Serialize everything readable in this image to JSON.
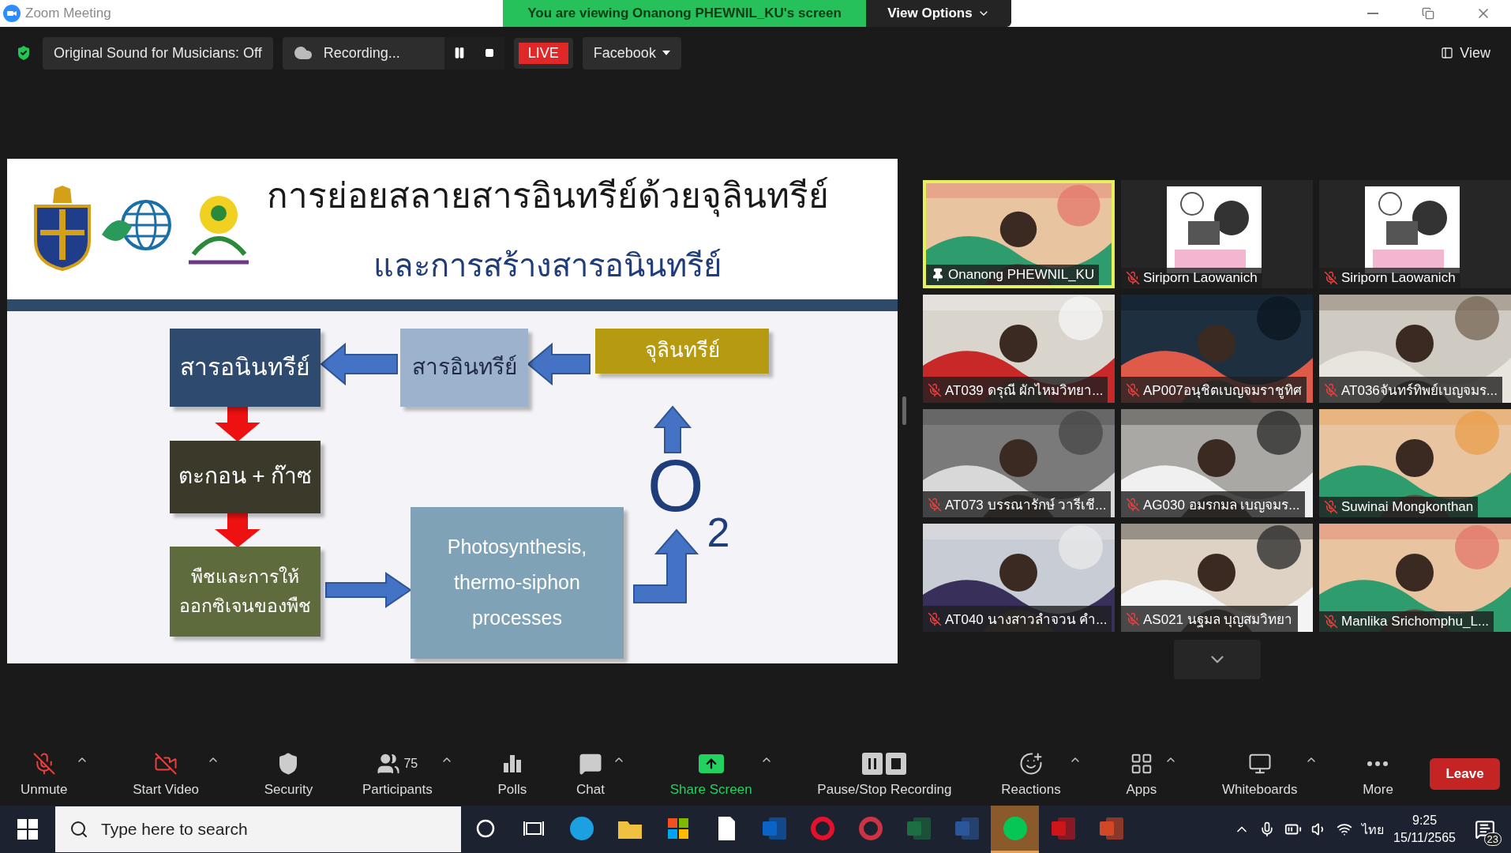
{
  "window": {
    "title": "Zoom Meeting",
    "banner": "You are viewing Onanong PHEWNIL_KU's screen",
    "view_options": "View Options"
  },
  "meeting_bar": {
    "sound_button": "Original Sound for Musicians: Off",
    "recording": "Recording...",
    "live": "LIVE",
    "stream_target": "Facebook",
    "view": "View"
  },
  "slide": {
    "title": "การย่อยสลายสารอินทรีย์ด้วยจุลินทรีย์",
    "subtitle": "และการสร้างสารอนินทรีย์",
    "nodes": [
      {
        "text": "สารอนินทรีย์",
        "color": "#2e4a6e"
      },
      {
        "text": "สารอินทรีย์",
        "color": "#9db2cc"
      },
      {
        "text": "จุลินทรีย์",
        "color": "#b59a12"
      },
      {
        "text": "ตะกอน + ก๊าซ",
        "color": "#3b3a2a"
      },
      {
        "text": "พืชและการให้ ออกซิเจนของพืช",
        "color": "#5e6b3c"
      },
      {
        "text": "Photosynthesis, thermo-siphon processes",
        "color": "#7fa2b6"
      }
    ],
    "formula": "O$_{2}$"
  },
  "participants": [
    {
      "name": "Onanong PHEWNIL_KU",
      "muted": false,
      "pinned": true,
      "active_speaker": true
    },
    {
      "name": "Siriporn Laowanich",
      "muted": true,
      "pinned": false,
      "active_speaker": false
    },
    {
      "name": "Siriporn Laowanich",
      "muted": true,
      "pinned": false,
      "active_speaker": false
    },
    {
      "name": "AT039 ดรุณี ผักไหมวิทยา...",
      "muted": true,
      "pinned": false,
      "active_speaker": false
    },
    {
      "name": "AP007อนุชิตเบญจมราชูทิศ",
      "muted": true,
      "pinned": false,
      "active_speaker": false
    },
    {
      "name": "AT036จันทร์ทิพย์เบญจมร...",
      "muted": true,
      "pinned": false,
      "active_speaker": false
    },
    {
      "name": "AT073 บรรณารักษ์ วารีเชี...",
      "muted": true,
      "pinned": false,
      "active_speaker": false
    },
    {
      "name": "AG030 อมรกมล เบญจมร...",
      "muted": true,
      "pinned": false,
      "active_speaker": false
    },
    {
      "name": "Suwinai Mongkonthan",
      "muted": true,
      "pinned": false,
      "active_speaker": false
    },
    {
      "name": "AT040 นางสาวลำจวน  คำ...",
      "muted": true,
      "pinned": false,
      "active_speaker": false
    },
    {
      "name": "AS021 นฐมล บุญสมวิทยา",
      "muted": true,
      "pinned": false,
      "active_speaker": false
    },
    {
      "name": "Manlika Srichomphu_L...",
      "muted": true,
      "pinned": false,
      "active_speaker": false
    }
  ],
  "toolbar": [
    {
      "kind": "mic",
      "label": "Unmute",
      "caret": true
    },
    {
      "kind": "video",
      "label": "Start Video",
      "caret": true
    },
    {
      "kind": "security",
      "label": "Security",
      "caret": false
    },
    {
      "kind": "participants",
      "label": "Participants",
      "count": "75",
      "caret": true
    },
    {
      "kind": "polls",
      "label": "Polls",
      "caret": false
    },
    {
      "kind": "chat",
      "label": "Chat",
      "caret": true
    },
    {
      "kind": "share",
      "label": "Share Screen",
      "caret": true
    },
    {
      "kind": "recording",
      "label": "Pause/Stop Recording",
      "caret": false
    },
    {
      "kind": "reactions",
      "label": "Reactions",
      "caret": true
    },
    {
      "kind": "apps",
      "label": "Apps",
      "caret": true
    },
    {
      "kind": "whiteboards",
      "label": "Whiteboards",
      "caret": true
    },
    {
      "kind": "more",
      "label": "More",
      "caret": false
    }
  ],
  "leave_button": "Leave",
  "taskbar": {
    "search": {
      "placeholder": "Type here to search"
    },
    "apps": [
      {
        "kind": "edge",
        "selected": false
      },
      {
        "kind": "folder",
        "selected": false
      },
      {
        "kind": "store",
        "selected": false
      },
      {
        "kind": "document",
        "selected": false
      },
      {
        "kind": "mail",
        "selected": false
      },
      {
        "kind": "opera",
        "selected": false
      },
      {
        "kind": "snip",
        "selected": false
      },
      {
        "kind": "spreadsheet",
        "selected": false
      },
      {
        "kind": "word",
        "selected": false
      },
      {
        "kind": "chat",
        "selected": true
      },
      {
        "kind": "pdf",
        "selected": false
      },
      {
        "kind": "slides",
        "selected": false
      }
    ],
    "language": "ไทย",
    "time": "9:25",
    "date": "15/11/2565",
    "notifications": "23"
  }
}
